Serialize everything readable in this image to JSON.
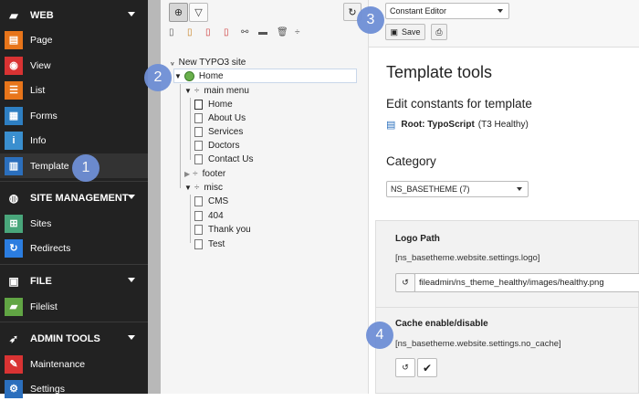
{
  "sidebar": {
    "sections": [
      {
        "label": "WEB",
        "icon": "stack-icon"
      },
      {
        "label": "SITE MANAGEMENT",
        "icon": "globe-icon"
      },
      {
        "label": "FILE",
        "icon": "image-icon"
      },
      {
        "label": "ADMIN TOOLS",
        "icon": "rocket-icon"
      }
    ],
    "items": [
      {
        "label": "Page",
        "color": "#e8751a",
        "icon": "page-icon",
        "glyph": "▤"
      },
      {
        "label": "View",
        "color": "#d93333",
        "icon": "eye-icon",
        "glyph": "◉"
      },
      {
        "label": "List",
        "color": "#e8751a",
        "icon": "list-icon",
        "glyph": "☰"
      },
      {
        "label": "Forms",
        "color": "#2e7fc2",
        "icon": "forms-icon",
        "glyph": "▦"
      },
      {
        "label": "Info",
        "color": "#3a8fcf",
        "icon": "info-icon",
        "glyph": "i"
      },
      {
        "label": "Template",
        "color": "#2b6fbd",
        "icon": "template-icon",
        "glyph": "▥"
      },
      {
        "label": "Sites",
        "color": "#49a67b",
        "icon": "sites-icon",
        "glyph": "⊞"
      },
      {
        "label": "Redirects",
        "color": "#2b7de0",
        "icon": "redirects-icon",
        "glyph": "↻"
      },
      {
        "label": "Filelist",
        "color": "#61a544",
        "icon": "filelist-icon",
        "glyph": "▰"
      },
      {
        "label": "Maintenance",
        "color": "#d93333",
        "icon": "wrench-icon",
        "glyph": "✎"
      },
      {
        "label": "Settings",
        "color": "#2b6fbd",
        "icon": "gears-icon",
        "glyph": "⚙"
      }
    ]
  },
  "badges": [
    "1",
    "2",
    "3",
    "4"
  ],
  "tree": {
    "root": "New TYPO3 site",
    "home": "Home",
    "main_menu": "main menu",
    "main_children": [
      "Home",
      "About Us",
      "Services",
      "Doctors",
      "Contact Us"
    ],
    "footer": "footer",
    "misc": "misc",
    "misc_children": [
      "CMS",
      "404",
      "Thank you",
      "Test"
    ]
  },
  "header": {
    "function_select": "Constant Editor",
    "save_label": "Save"
  },
  "content": {
    "title": "Template tools",
    "subtitle": "Edit constants for template",
    "root_label": "Root: TypoScript",
    "root_suffix": "(T3 Healthy)",
    "category_label": "Category",
    "category_value": "NS_BASETHEME (7)",
    "logo": {
      "label": "Logo Path",
      "key": "[ns_basetheme.website.settings.logo]",
      "value": "fileadmin/ns_theme_healthy/images/healthy.png"
    },
    "cache": {
      "label": "Cache enable/disable",
      "key": "[ns_basetheme.website.settings.no_cache]"
    }
  }
}
